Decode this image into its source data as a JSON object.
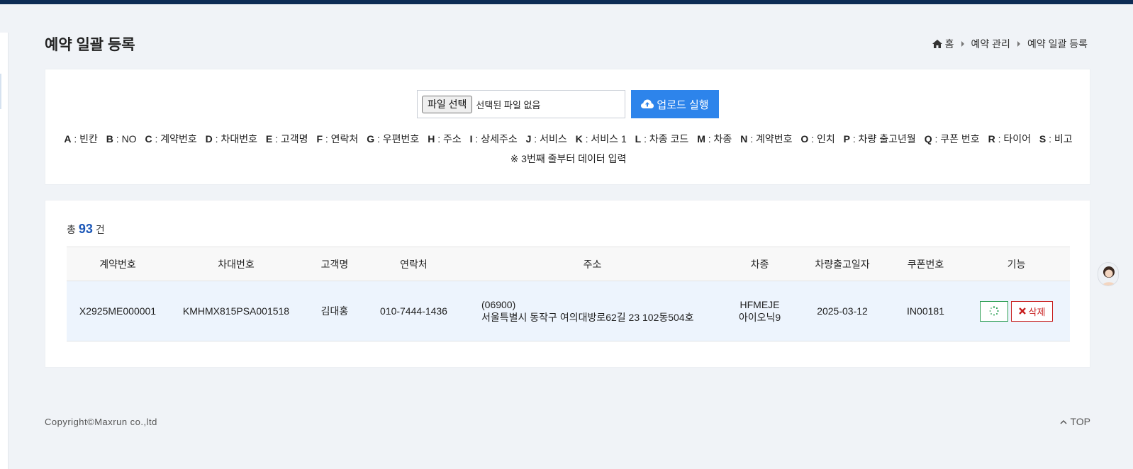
{
  "header": {
    "page_title": "예약 일괄 등록",
    "breadcrumb": [
      "홈",
      "예약 관리",
      "예약 일괄 등록"
    ]
  },
  "upload": {
    "file_button_label": "파일 선택",
    "file_status": "선택된 파일 없음",
    "upload_button_label": "업로드 실행",
    "columns": [
      {
        "key": "A",
        "label": "빈칸"
      },
      {
        "key": "B",
        "label": "NO"
      },
      {
        "key": "C",
        "label": "계약번호"
      },
      {
        "key": "D",
        "label": "차대번호"
      },
      {
        "key": "E",
        "label": "고객명"
      },
      {
        "key": "F",
        "label": "연락처"
      },
      {
        "key": "G",
        "label": "우편번호"
      },
      {
        "key": "H",
        "label": "주소"
      },
      {
        "key": "I",
        "label": "상세주소"
      },
      {
        "key": "J",
        "label": "서비스"
      },
      {
        "key": "K",
        "label": "서비스 1"
      },
      {
        "key": "L",
        "label": "차종 코드"
      },
      {
        "key": "M",
        "label": "차종"
      },
      {
        "key": "N",
        "label": "계약번호"
      },
      {
        "key": "O",
        "label": "인치"
      },
      {
        "key": "P",
        "label": "차량 출고년월"
      },
      {
        "key": "Q",
        "label": "쿠폰 번호"
      },
      {
        "key": "R",
        "label": "타이어"
      },
      {
        "key": "S",
        "label": "비고"
      }
    ],
    "separator": " : ",
    "note": "※ 3번째 줄부터 데이터 입력"
  },
  "list": {
    "total_prefix": "총",
    "total_count": "93",
    "total_suffix": "건",
    "headers": [
      "계약번호",
      "차대번호",
      "고객명",
      "연락처",
      "주소",
      "차종",
      "차량출고일자",
      "쿠폰번호",
      "기능"
    ],
    "rows": [
      {
        "contract_no": "X2925ME000001",
        "vin": "KMHMX815PSA001518",
        "customer": "김대홍",
        "phone": "010-7444-1436",
        "postcode": "(06900)",
        "address": "서울특별시 동작구 여의대방로62길 23 102동504호",
        "model_code": "HFMEJE",
        "model_name": "아이오닉9",
        "release_date": "2025-03-12",
        "coupon": "IN00181",
        "delete_label": "삭제"
      }
    ]
  },
  "footer": {
    "copyright": "Copyright©Maxrun co.,ltd",
    "top_label": "TOP"
  },
  "colors": {
    "top_bar": "#0d2c55",
    "primary_button": "#2d84eb",
    "count_accent": "#1d58b8",
    "edit_border": "#2a9d52",
    "delete_red": "#c81e1e",
    "row_highlight": "#edf4fd"
  },
  "icons": {
    "breadcrumb_home": "home-icon",
    "breadcrumb_separator": "caret-right-icon",
    "upload": "cloud-upload-icon",
    "edit": "spinner-icon",
    "delete": "close-icon",
    "top": "chevron-up-icon"
  }
}
